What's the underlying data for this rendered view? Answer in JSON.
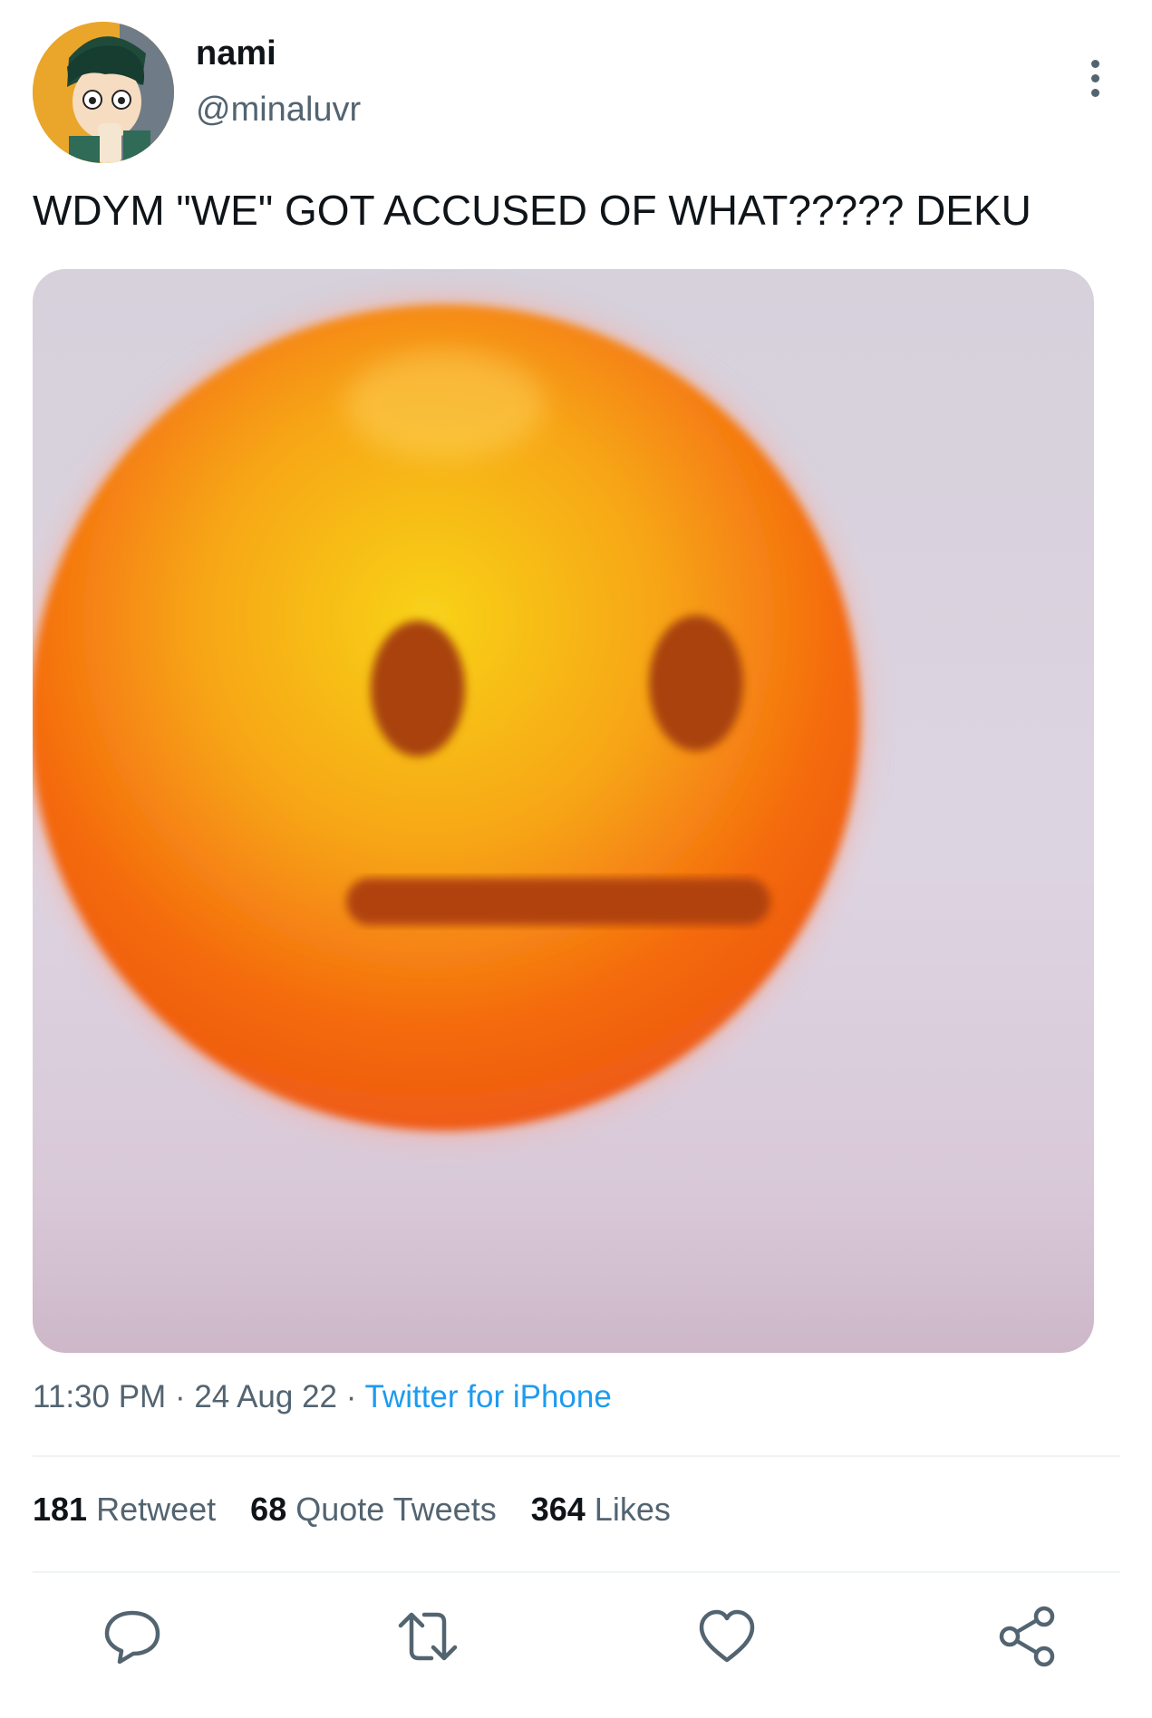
{
  "tweet": {
    "author": {
      "display_name": "nami",
      "handle": "@minaluvr"
    },
    "text": "WDYM \"WE\" GOT ACCUSED OF WHAT????? DEKU",
    "time": "11:30 PM",
    "separator": "·",
    "date": "24 Aug 22",
    "source": "Twitter for iPhone"
  },
  "stats": {
    "retweets_count": "181",
    "retweets_label": "Retweet",
    "quotes_count": "68",
    "quotes_label": "Quote Tweets",
    "likes_count": "364",
    "likes_label": "Likes"
  },
  "icons": {
    "more": "more-vertical-icon",
    "reply": "reply-icon",
    "retweet": "retweet-icon",
    "like": "heart-icon",
    "share": "share-icon"
  },
  "colors": {
    "text": "#0f1419",
    "secondary": "#536471",
    "link": "#1d9bf0",
    "divider": "#eff3f4"
  }
}
